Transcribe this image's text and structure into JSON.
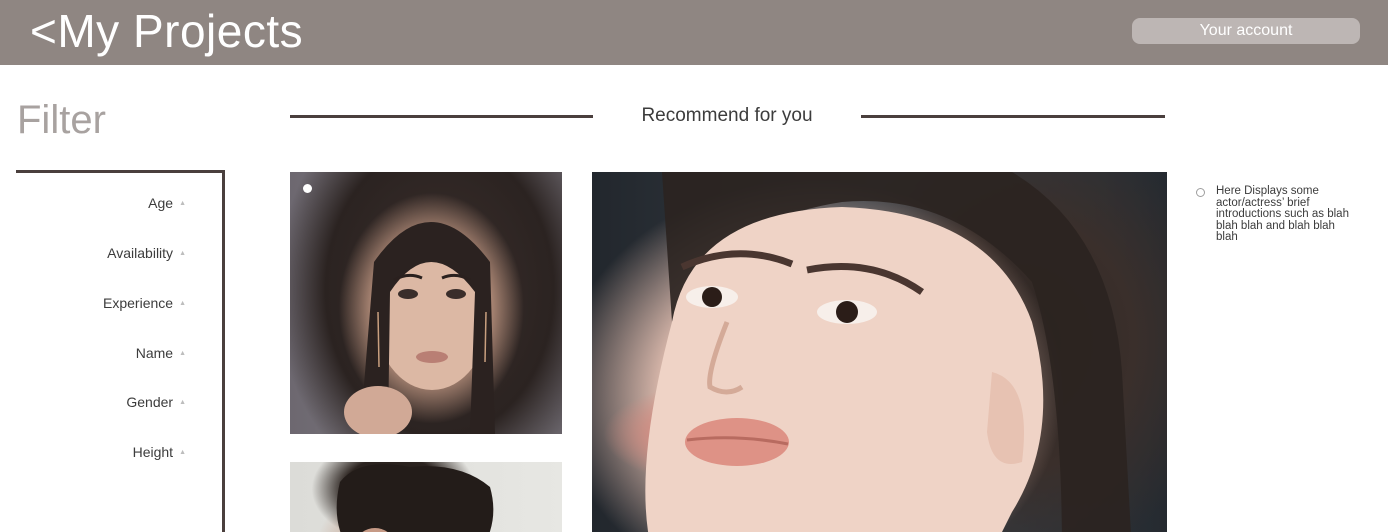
{
  "header": {
    "title": "<My Projects",
    "account_label": "Your account"
  },
  "filter": {
    "heading": "Filter",
    "items": [
      {
        "label": "Age"
      },
      {
        "label": "Availability"
      },
      {
        "label": "Experience"
      },
      {
        "label": "Name"
      },
      {
        "label": "Gender"
      },
      {
        "label": "Height"
      }
    ]
  },
  "recommend": {
    "title": "Recommend for you"
  },
  "intro": {
    "text": "Here Displays some actor/actress’ brief introductions such as blah blah blah and blah blah blah"
  },
  "colors": {
    "header_bg": "#8f8682",
    "accent_line": "#4a3f3d",
    "account_button_bg": "#bdb6b4"
  }
}
